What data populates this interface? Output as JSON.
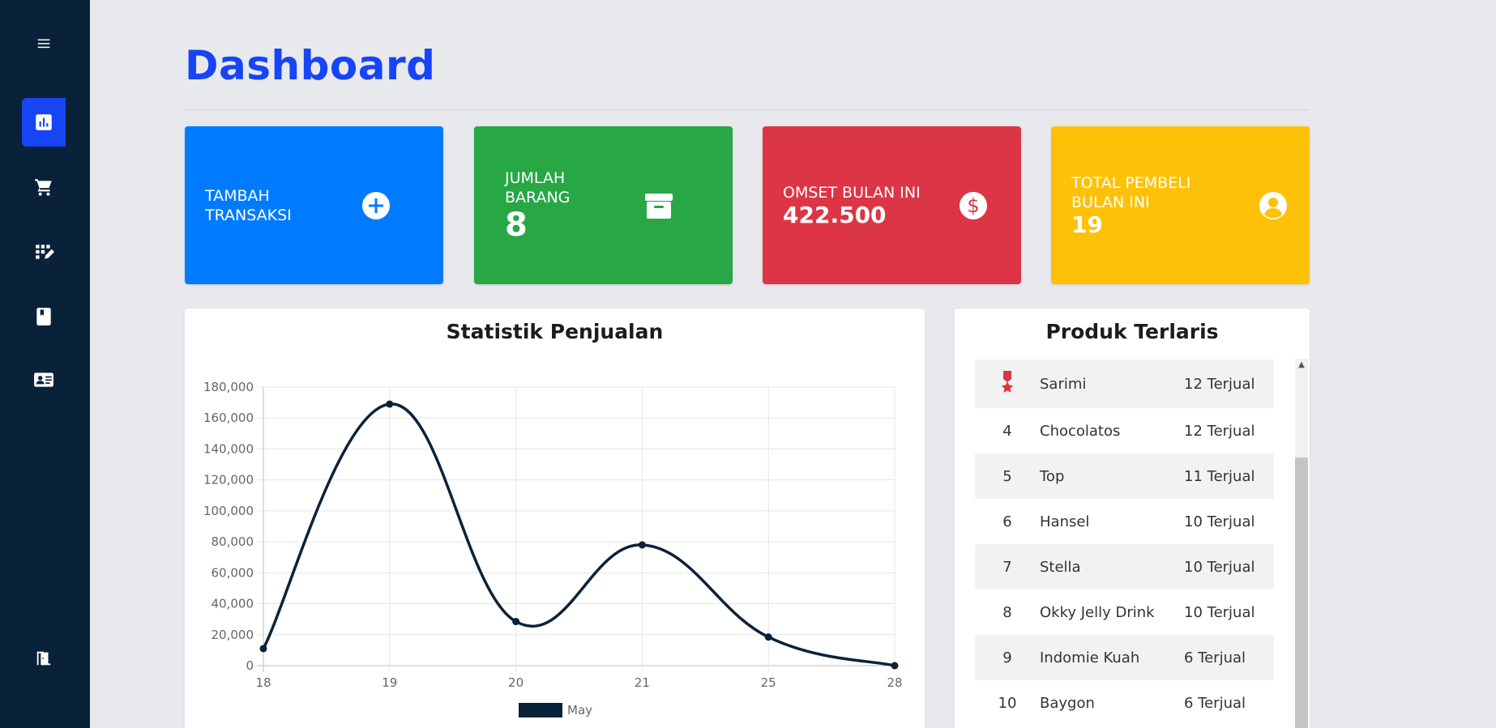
{
  "page": {
    "title": "Dashboard"
  },
  "sidebar": {
    "items": [
      {
        "icon": "menu-icon"
      },
      {
        "icon": "bar-chart-icon",
        "active": true
      },
      {
        "icon": "cart-icon"
      },
      {
        "icon": "edit-grid-icon"
      },
      {
        "icon": "book-icon"
      },
      {
        "icon": "id-card-icon"
      },
      {
        "icon": "logout-door-icon"
      }
    ]
  },
  "cards": [
    {
      "label": "TAMBAH TRANSAKSI",
      "value": "",
      "color": "#007bff",
      "icon": "plus-circle-icon"
    },
    {
      "label": "JUMLAH BARANG",
      "value": "8",
      "color": "#28a745",
      "icon": "archive-box-icon"
    },
    {
      "label": "OMSET BULAN INI",
      "value": "422.500",
      "color": "#dc3545",
      "icon": "dollar-circle-icon"
    },
    {
      "label": "TOTAL PEMBELI BULAN INI",
      "value": "19",
      "color": "#ffc107",
      "icon": "user-circle-icon"
    }
  ],
  "chart_panel": {
    "title": "Statistik Penjualan"
  },
  "top_panel": {
    "title": "Produk Terlaris",
    "rows": [
      {
        "no": "",
        "name": "Sarimi",
        "sold": "12 Terjual",
        "icon": "medal-icon"
      },
      {
        "no": "4",
        "name": "Chocolatos",
        "sold": "12 Terjual"
      },
      {
        "no": "5",
        "name": "Top",
        "sold": "11 Terjual"
      },
      {
        "no": "6",
        "name": "Hansel",
        "sold": "10 Terjual"
      },
      {
        "no": "7",
        "name": "Stella",
        "sold": "10 Terjual"
      },
      {
        "no": "8",
        "name": "Okky Jelly Drink",
        "sold": "10 Terjual"
      },
      {
        "no": "9",
        "name": "Indomie Kuah",
        "sold": "6 Terjual"
      },
      {
        "no": "10",
        "name": "Baygon",
        "sold": "6 Terjual"
      }
    ]
  },
  "chart_data": {
    "type": "line",
    "categories": [
      "18",
      "19",
      "20",
      "21",
      "25",
      "28"
    ],
    "series": [
      {
        "name": "May",
        "values": [
          11000,
          169000,
          28500,
          78000,
          18500,
          0
        ],
        "color": "#0a2239"
      }
    ],
    "yticks": [
      "0",
      "20,000",
      "40,000",
      "60,000",
      "80,000",
      "100,000",
      "120,000",
      "140,000",
      "160,000",
      "180,000"
    ],
    "ylim": [
      0,
      180000
    ],
    "grid": true,
    "legend": "bottom"
  },
  "colors": {
    "sidebar": "#0a2239",
    "accent": "#1744f5",
    "background": "#e8e9ed"
  }
}
